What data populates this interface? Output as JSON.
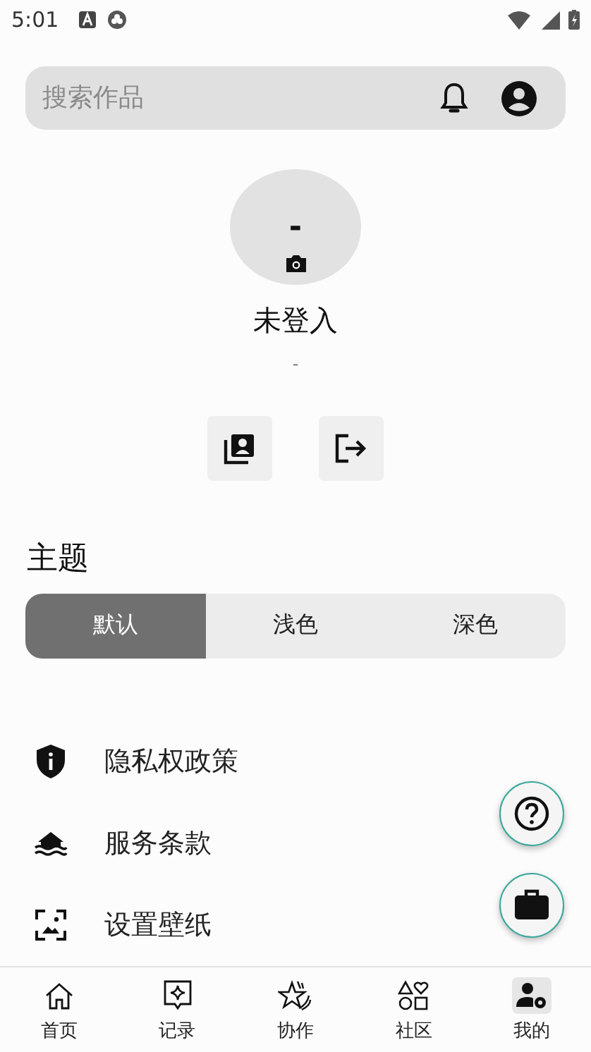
{
  "status_bar": {
    "time": "5:01"
  },
  "search": {
    "placeholder": "搜索作品"
  },
  "profile": {
    "avatar_text": "-",
    "name": "未登入",
    "subtitle": "-"
  },
  "theme": {
    "title": "主题",
    "options": [
      {
        "label": "默认",
        "selected": true
      },
      {
        "label": "浅色",
        "selected": false
      },
      {
        "label": "深色",
        "selected": false
      }
    ]
  },
  "menu": [
    {
      "label": "隐私权政策"
    },
    {
      "label": "服务条款"
    },
    {
      "label": "设置壁纸"
    }
  ],
  "bottom_nav": [
    {
      "label": "首页",
      "selected": false
    },
    {
      "label": "记录",
      "selected": false
    },
    {
      "label": "协作",
      "selected": false
    },
    {
      "label": "社区",
      "selected": false
    },
    {
      "label": "我的",
      "selected": true
    }
  ]
}
